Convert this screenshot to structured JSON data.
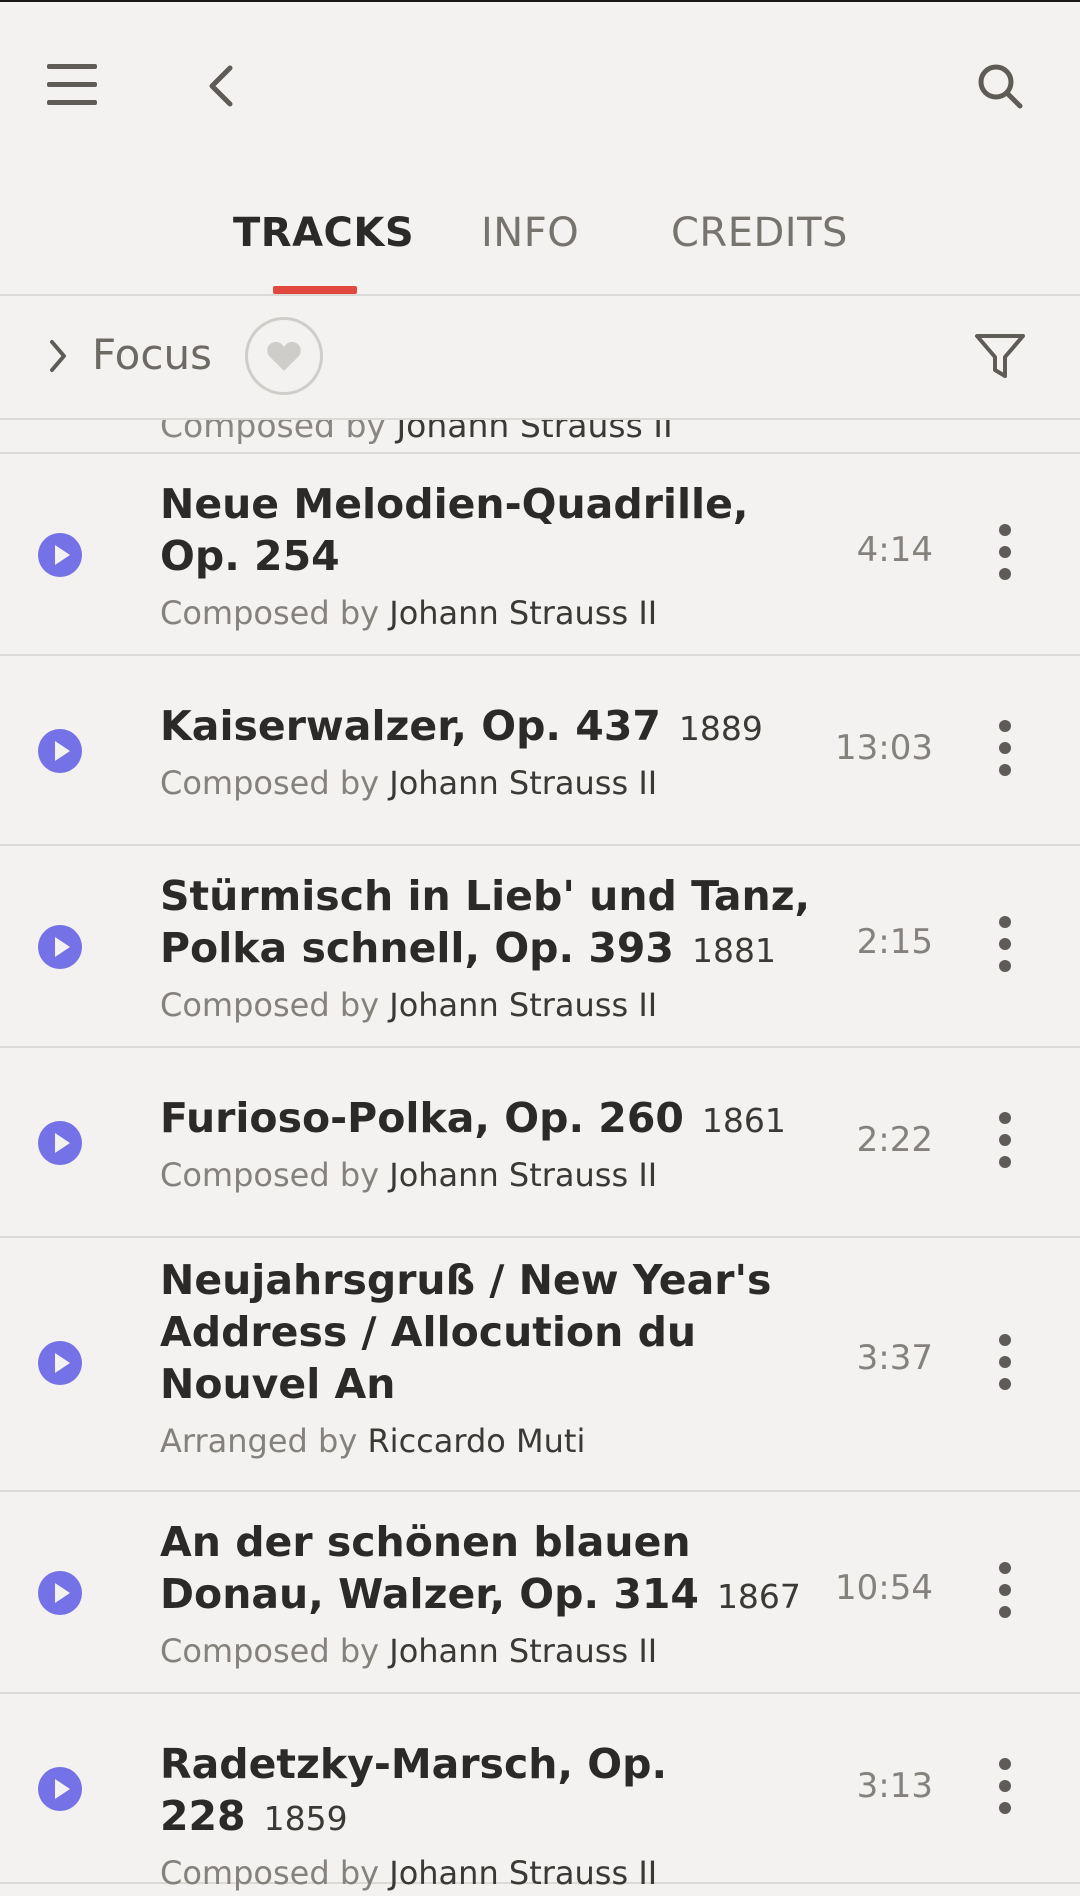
{
  "header": {
    "menu_icon": "hamburger-menu-icon",
    "back_icon": "chevron-left-icon",
    "search_icon": "search-icon"
  },
  "tabs": [
    {
      "label": "TRACKS",
      "active": true
    },
    {
      "label": "INFO",
      "active": false
    },
    {
      "label": "CREDITS",
      "active": false
    }
  ],
  "filter_bar": {
    "focus_label": "Focus",
    "heart_icon": "heart-icon",
    "filter_icon": "filter-icon"
  },
  "colors": {
    "accent": "#e2483d",
    "play": "#7472e6",
    "background": "#f3f2f0"
  },
  "tracks": [
    {
      "title": "Neue Melodien-Quadrille, Op. 254",
      "year": "",
      "role": "Composed by",
      "person": "Johann Strauss II",
      "duration": "4:14"
    },
    {
      "title": "Kaiserwalzer, Op. 437",
      "year": "1889",
      "role": "Composed by",
      "person": "Johann Strauss II",
      "duration": "13:03"
    },
    {
      "title": "Stürmisch in Lieb' und Tanz, Polka schnell, Op. 393",
      "year": "1881",
      "role": "Composed by",
      "person": "Johann Strauss II",
      "duration": "2:15"
    },
    {
      "title": "Furioso-Polka, Op. 260",
      "year": "1861",
      "role": "Composed by",
      "person": "Johann Strauss II",
      "duration": "2:22"
    },
    {
      "title": "Neujahrsgruß / New Year's Address / Allocution du Nouvel An",
      "year": "",
      "role": "Arranged by",
      "person": "Riccardo Muti",
      "duration": "3:37"
    },
    {
      "title": "An der schönen blauen Donau, Walzer, Op. 314",
      "year": "1867",
      "role": "Composed by",
      "person": "Johann Strauss II",
      "duration": "10:54"
    },
    {
      "title": "Radetzky-Marsch, Op. 228",
      "year": "1859",
      "role": "Composed by",
      "person": "Johann Strauss II",
      "duration": "3:13"
    }
  ]
}
